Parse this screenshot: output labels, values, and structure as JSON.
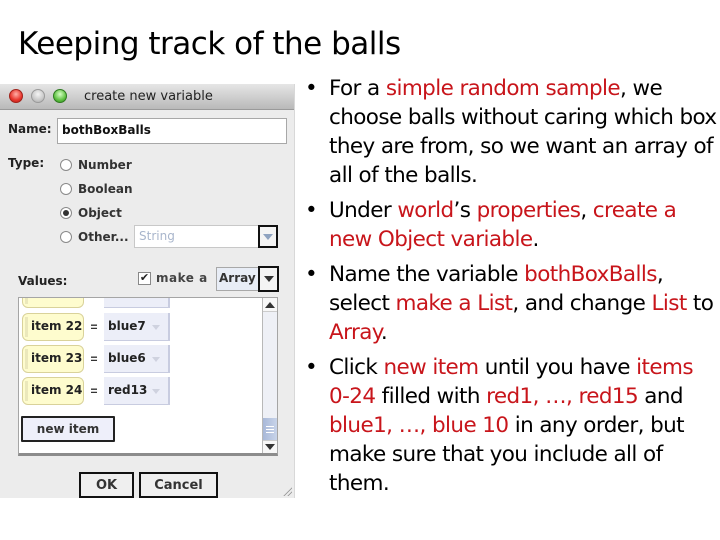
{
  "slide": {
    "title": "Keeping track of the balls"
  },
  "dialog": {
    "window_title": "create new variable",
    "window_controls": [
      "close",
      "minimize",
      "zoom"
    ],
    "name_label": "Name:",
    "name_value": "bothBoxBalls",
    "type_label": "Type:",
    "type_options": [
      {
        "label": "Number",
        "selected": false
      },
      {
        "label": "Boolean",
        "selected": false
      },
      {
        "label": "Object",
        "selected": true
      },
      {
        "label": "Other...",
        "selected": false
      }
    ],
    "other_type_value": "String",
    "values_label": "Values:",
    "make_a_checked": true,
    "make_a_label": "make a",
    "collection_type": "Array",
    "items": [
      {
        "label": "item 22",
        "eq": "=",
        "value": "blue7"
      },
      {
        "label": "item 23",
        "eq": "=",
        "value": "blue6"
      },
      {
        "label": "item 24",
        "eq": "=",
        "value": "red13"
      }
    ],
    "new_item_label": "new item",
    "ok_label": "OK",
    "cancel_label": "Cancel"
  },
  "bullets": [
    [
      {
        "t": "For a ",
        "hl": false
      },
      {
        "t": "simple random sample",
        "hl": true
      },
      {
        "t": ", we choose balls without caring which box they are from, so we want an array of all of the balls.",
        "hl": false
      }
    ],
    [
      {
        "t": "Under ",
        "hl": false
      },
      {
        "t": "world",
        "hl": true
      },
      {
        "t": "’s ",
        "hl": false
      },
      {
        "t": "properties",
        "hl": true
      },
      {
        "t": ", ",
        "hl": false
      },
      {
        "t": "create a new Object variable",
        "hl": true
      },
      {
        "t": ".",
        "hl": false
      }
    ],
    [
      {
        "t": "Name the variable ",
        "hl": false
      },
      {
        "t": "bothBoxBalls",
        "hl": true
      },
      {
        "t": ", select ",
        "hl": false
      },
      {
        "t": "make a List",
        "hl": true
      },
      {
        "t": ", and change ",
        "hl": false
      },
      {
        "t": "List",
        "hl": true
      },
      {
        "t": " to ",
        "hl": false
      },
      {
        "t": "Array",
        "hl": true
      },
      {
        "t": ".",
        "hl": false
      }
    ],
    [
      {
        "t": "Click ",
        "hl": false
      },
      {
        "t": "new item",
        "hl": true
      },
      {
        "t": " until you have ",
        "hl": false
      },
      {
        "t": "items 0-24",
        "hl": true
      },
      {
        "t": " filled with ",
        "hl": false
      },
      {
        "t": "red1, …, red15",
        "hl": true
      },
      {
        "t": " and ",
        "hl": false
      },
      {
        "t": "blue1, …, blue 10",
        "hl": true
      },
      {
        "t": " in any order, but make sure that you include all of them.",
        "hl": false
      }
    ]
  ],
  "colors": {
    "highlight": "#c8151b",
    "item_tile": "#fefcce",
    "value_tile": "#eceef8"
  }
}
